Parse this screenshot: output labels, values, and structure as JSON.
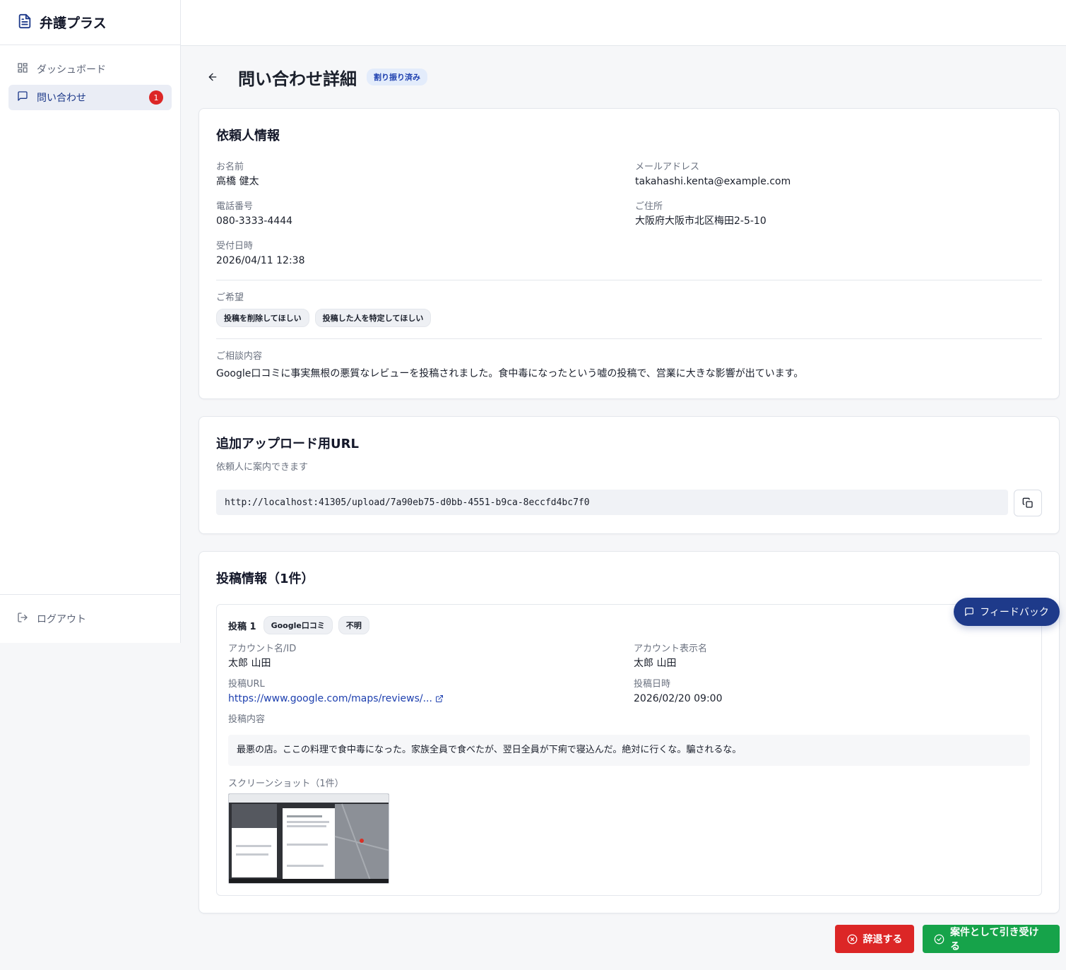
{
  "app": {
    "title": "弁護プラス"
  },
  "sidebar": {
    "items": [
      {
        "label": "ダッシュボード"
      },
      {
        "label": "問い合わせ",
        "badge": "1"
      }
    ],
    "logout_label": "ログアウト"
  },
  "page": {
    "title": "問い合わせ詳細",
    "status": "割り振り済み"
  },
  "client": {
    "title": "依頼人情報",
    "name_label": "お名前",
    "name": "高橋 健太",
    "email_label": "メールアドレス",
    "email": "takahashi.kenta@example.com",
    "phone_label": "電話番号",
    "phone": "080-3333-4444",
    "address_label": "ご住所",
    "address": "大阪府大阪市北区梅田2-5-10",
    "received_label": "受付日時",
    "received": "2026/04/11 12:38",
    "wishes_label": "ご希望",
    "wishes": [
      "投稿を削除してほしい",
      "投稿した人を特定してほしい"
    ],
    "consult_label": "ご相談内容",
    "consult": "Google口コミに事実無根の悪質なレビューを投稿されました。食中毒になったという嘘の投稿で、営業に大きな影響が出ています。"
  },
  "upload": {
    "title": "追加アップロード用URL",
    "subtitle": "依頼人に案内できます",
    "url": "http://localhost:41305/upload/7a90eb75-d0bb-4551-b9ca-8eccfd4bc7f0"
  },
  "posts": {
    "title": "投稿情報（1件）",
    "items": [
      {
        "number": "投稿 1",
        "platform": "Google口コミ",
        "unknown": "不明",
        "account_label": "アカウント名/ID",
        "account": "太郎 山田",
        "display_label": "アカウント表示名",
        "display": "太郎 山田",
        "url_label": "投稿URL",
        "url": "https://www.google.com/maps/reviews/...",
        "date_label": "投稿日時",
        "date": "2026/02/20 09:00",
        "content_label": "投稿内容",
        "content": "最悪の店。ここの料理で食中毒になった。家族全員で食べたが、翌日全員が下痢で寝込んだ。絶対に行くな。騙されるな。",
        "screenshot_label": "スクリーンショット（1件）"
      }
    ]
  },
  "feedback_label": "フィードバック",
  "actions": {
    "decline": "辞退する",
    "accept": "案件として引き受ける"
  },
  "colors": {
    "brand": "#1e3a8a",
    "danger": "#dc2626",
    "success": "#16a34a",
    "badge_bg": "#e3ecfb"
  }
}
